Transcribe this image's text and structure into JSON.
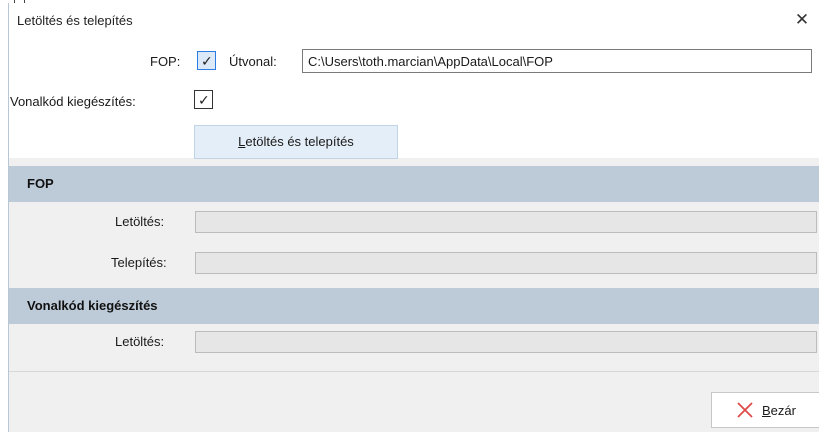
{
  "window": {
    "title": "Letöltés és telepítés"
  },
  "options": {
    "fop_label": "FOP:",
    "fop_checked": true,
    "path_label": "Útvonal:",
    "path_value": "C:\\Users\\toth.marcian\\AppData\\Local\\FOP",
    "barcode_label": "Vonalkód kiegészítés:",
    "barcode_checked": true
  },
  "download_button": {
    "mnemonic": "L",
    "rest": "etöltés és telepítés"
  },
  "sections": [
    {
      "title": "FOP",
      "rows": [
        {
          "label": "Letöltés:",
          "progress": 0
        },
        {
          "label": "Telepítés:",
          "progress": 0
        }
      ]
    },
    {
      "title": "Vonalkód kiegészítés",
      "rows": [
        {
          "label": "Letöltés:",
          "progress": 0
        }
      ]
    }
  ],
  "close_button": {
    "mnemonic": "B",
    "rest": "ezár"
  },
  "icons": {
    "close_window": "close-icon",
    "close_button": "red-x-icon",
    "check": "checkmark-icon"
  },
  "colors": {
    "section_header": "#bdcbd9",
    "focus_border": "#2b7de1",
    "close_x_red": "#e04848"
  }
}
